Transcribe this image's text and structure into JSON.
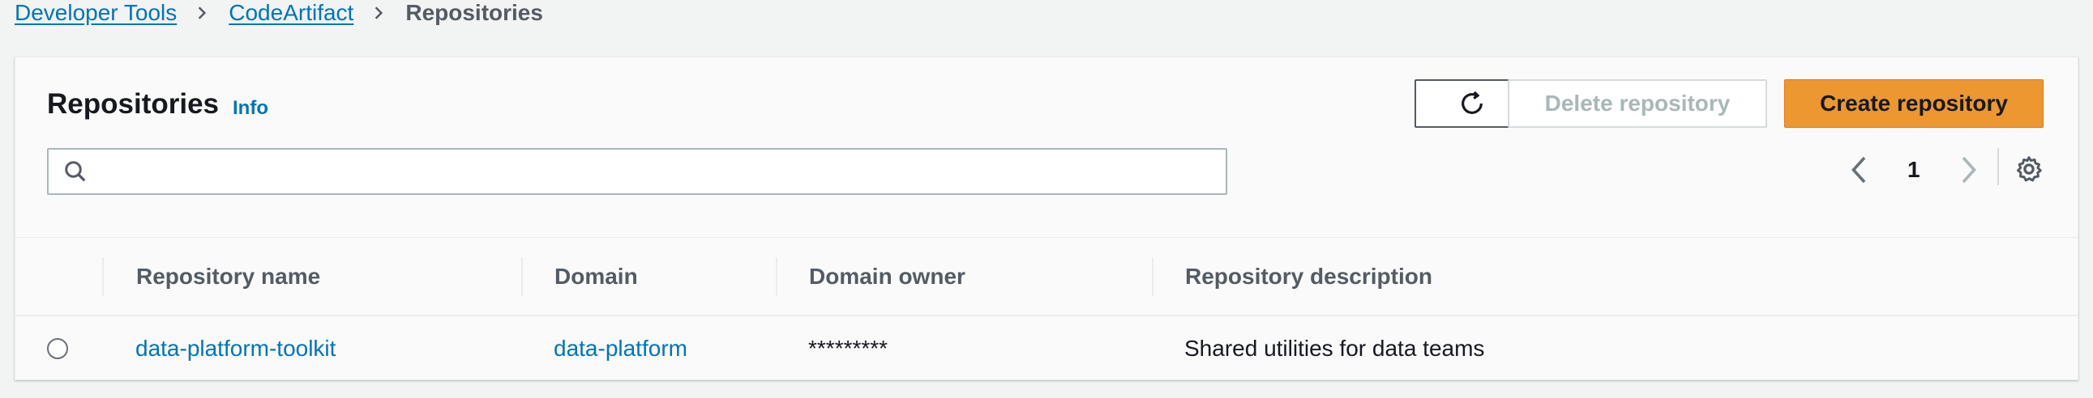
{
  "breadcrumb": {
    "items": [
      "Developer Tools",
      "CodeArtifact"
    ],
    "current": "Repositories"
  },
  "panel": {
    "title": "Repositories",
    "info_label": "Info",
    "buttons": {
      "delete_label": "Delete repository",
      "create_label": "Create repository"
    },
    "search": {
      "placeholder": "",
      "value": ""
    },
    "pagination": {
      "current_page": "1"
    }
  },
  "table": {
    "columns": [
      "Repository name",
      "Domain",
      "Domain owner",
      "Repository description"
    ],
    "rows": [
      {
        "repository_name": "data-platform-toolkit",
        "domain": "data-platform",
        "domain_owner": "*********",
        "description": "Shared utilities for data teams"
      }
    ]
  },
  "colors": {
    "link": "#0073bb",
    "primary_button": "#ec972f",
    "disabled_text": "#aab7b8",
    "background": "#f2f3f3"
  },
  "icons": [
    "chevron-right-icon",
    "refresh-icon",
    "search-icon",
    "chevron-left-icon",
    "chevron-right-icon",
    "settings-gear-icon"
  ]
}
